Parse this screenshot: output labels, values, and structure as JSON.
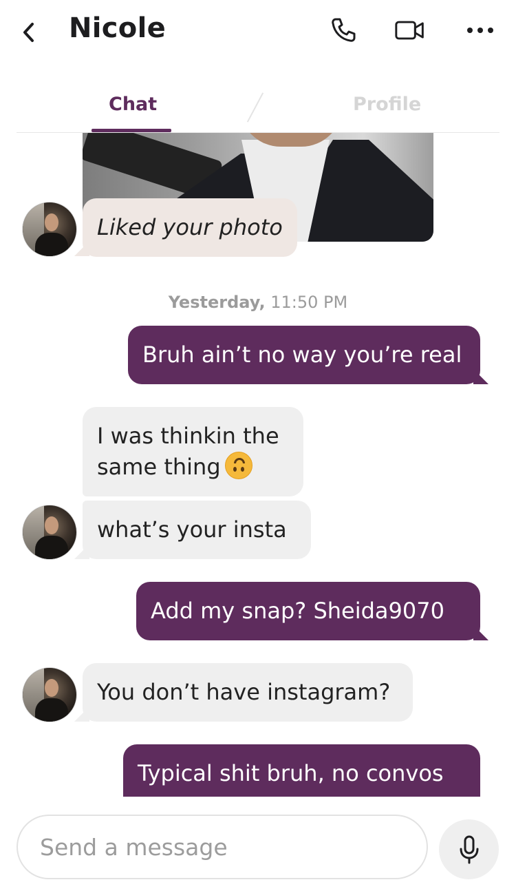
{
  "header": {
    "title": "Nicole",
    "icons": [
      "back-icon",
      "phone-icon",
      "video-icon",
      "more-icon"
    ]
  },
  "tabs": [
    {
      "label": "Chat",
      "active": true
    },
    {
      "label": "Profile",
      "active": false
    }
  ],
  "messages": {
    "liked": "Liked your photo",
    "timestamp_day": "Yesterday,",
    "timestamp_time": "11:50 PM",
    "m1": "Bruh ain’t no way you’re real",
    "m2": "I was thinkin the same thing",
    "m3": "what’s your insta",
    "m4": "Add my snap? Sheida9070",
    "m5": "You don’t have instagram?",
    "m6": "Typical shit bruh, no convos"
  },
  "composer": {
    "placeholder": "Send a message"
  },
  "colors": {
    "brand": "#5e2c5d",
    "incoming": "#efefef",
    "liked": "#efe7e3",
    "muted": "#9b9b9b"
  }
}
